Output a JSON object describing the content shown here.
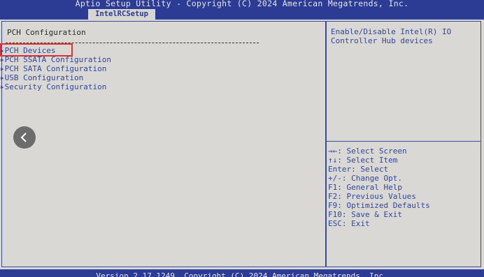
{
  "header": {
    "title": "Aptio Setup Utility - Copyright (C) 2024 American Megatrends, Inc.",
    "tab_label": "IntelRCSetup"
  },
  "main": {
    "section_title": "PCH Configuration",
    "menu_items": [
      {
        "label": "PCH Devices",
        "selected": true
      },
      {
        "label": "PCH SSATA Configuration"
      },
      {
        "label": "PCH SATA Configuration"
      },
      {
        "label": "USB Configuration"
      },
      {
        "label": "Security Configuration"
      }
    ]
  },
  "help": {
    "line1": "Enable/Disable Intel(R) IO",
    "line2": "Controller Hub devices"
  },
  "keys": [
    "→←: Select Screen",
    "↑↓: Select Item",
    "Enter: Select",
    "+/-: Change Opt.",
    "F1: General Help",
    "F2: Previous Values",
    "F9: Optimized Defaults",
    "F10: Save & Exit",
    "ESC: Exit"
  ],
  "footer": {
    "text": "Version 2.17.1249. Copyright (C) 2024 American Megatrends, Inc."
  },
  "overlay": {
    "nav_icon": "chevron-left-icon"
  }
}
